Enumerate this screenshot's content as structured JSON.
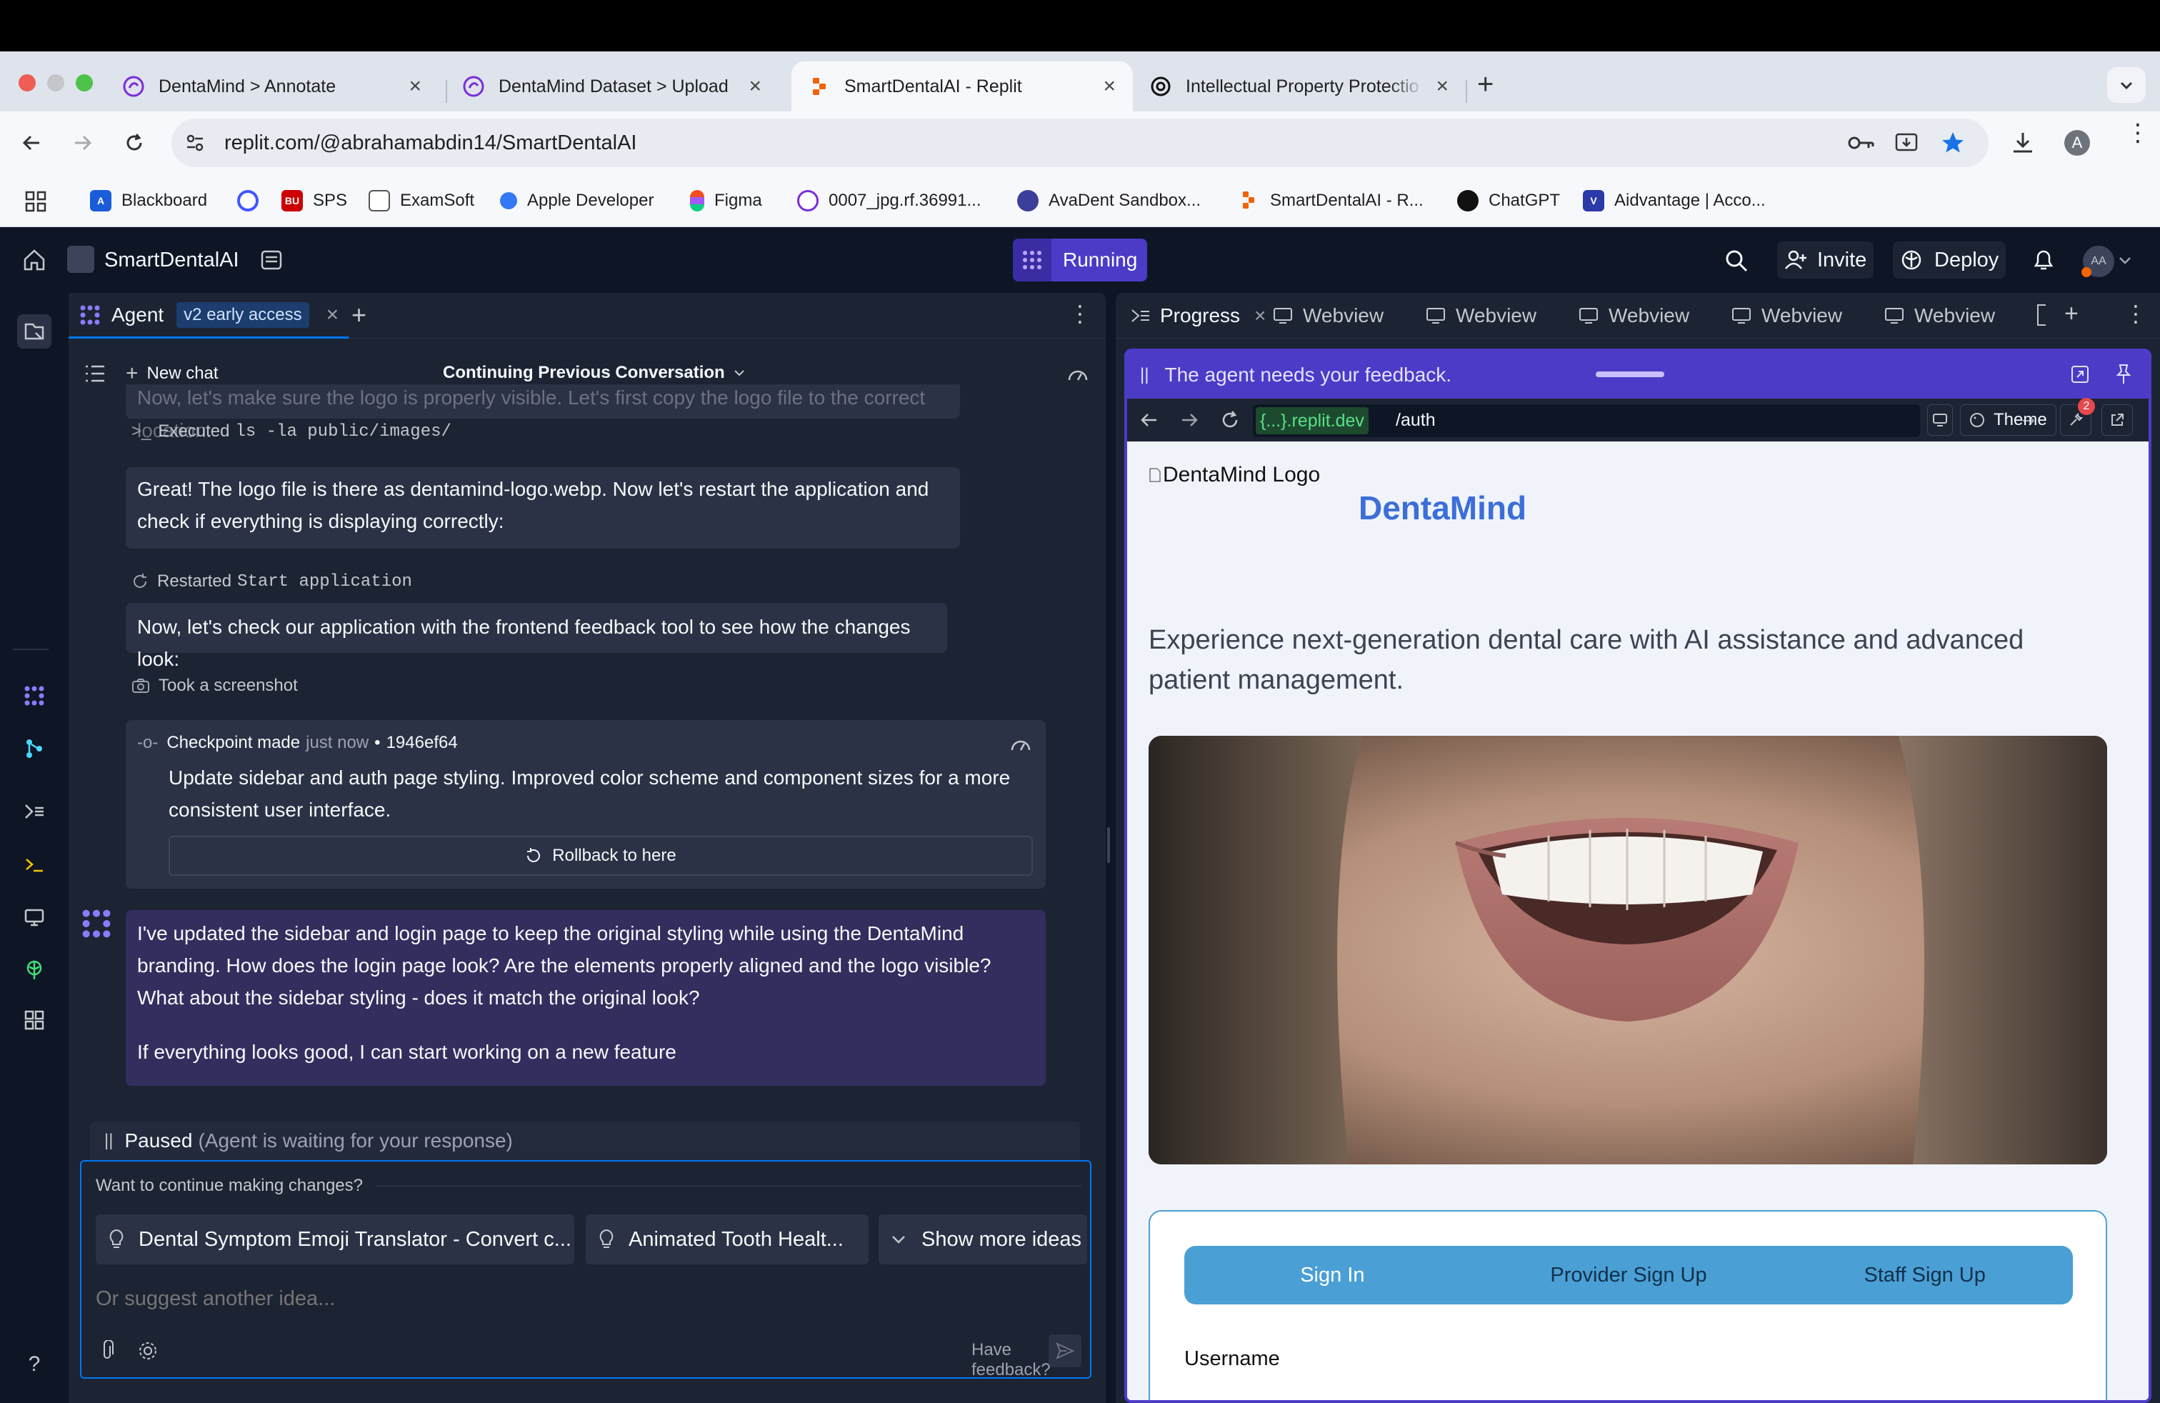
{
  "browser": {
    "tabs": [
      {
        "title": "DentaMind > Annotate",
        "favicon": "dentamind-icon"
      },
      {
        "title": "DentaMind Dataset > Upload",
        "favicon": "dentamind-icon"
      },
      {
        "title": "SmartDentalAI - Replit",
        "favicon": "replit-icon",
        "active": true
      },
      {
        "title": "Intellectual Property Protectio",
        "favicon": "chatgpt-icon"
      }
    ],
    "url": "replit.com/@abrahamabdin14/SmartDentalAI",
    "profile_initial": "A",
    "bookmarks": [
      {
        "label": "Blackboard",
        "icon": "blackboard-icon",
        "color": "#1a5dd8"
      },
      {
        "label": "",
        "icon": "quizlet-icon",
        "color": "#4255ff"
      },
      {
        "label": "SPS",
        "icon": "bu-icon",
        "color": "#cc0000",
        "badge": "BU"
      },
      {
        "label": "ExamSoft",
        "icon": "examsoft-icon",
        "color": "#555555"
      },
      {
        "label": "Apple Developer",
        "icon": "apple-icon",
        "color": "#3478f6"
      },
      {
        "label": "Figma",
        "icon": "figma-icon",
        "color": "#f24e1e"
      },
      {
        "label": "0007_jpg.rf.36991...",
        "icon": "dentamind-icon",
        "color": "#7b2fd6"
      },
      {
        "label": "AvaDent Sandbox...",
        "icon": "avadent-icon",
        "color": "#3b3f9a"
      },
      {
        "label": "SmartDentalAI - R...",
        "icon": "replit-icon",
        "color": "#f26207"
      },
      {
        "label": "ChatGPT",
        "icon": "chatgpt-icon",
        "color": "#111111"
      },
      {
        "label": "Aidvantage | Acco...",
        "icon": "aidvantage-icon",
        "color": "#2b3aa8",
        "badge": "V"
      }
    ]
  },
  "replit": {
    "project_name": "SmartDentalAI",
    "run_status": "Running",
    "invite_label": "Invite",
    "deploy_label": "Deploy",
    "avatar_initials": "AA",
    "colors": {
      "accent": "#5d3fd3",
      "background": "#0e1525",
      "surface": "#1c2333",
      "card": "#2b3245"
    }
  },
  "agent": {
    "tab_label": "Agent",
    "badge": "v2 early access",
    "new_chat_label": "New chat",
    "conversation_title": "Continuing Previous Conversation",
    "faded_message": "Now, let's make sure the logo is properly visible. Let's first copy the logo file to the correct location:",
    "executed_prefix": "Executed",
    "executed_command": "ls -la public/images/",
    "message_1": "Great! The logo file is there as dentamind-logo.webp. Now let's restart the application and check if everything is displaying correctly:",
    "restarted_prefix": "Restarted",
    "restarted_target": "Start application",
    "message_2": "Now, let's check our application with the frontend feedback tool to see how the changes look:",
    "screenshot_label": "Took a screenshot",
    "checkpoint": {
      "label": "Checkpoint made",
      "time": "just now",
      "hash": "1946ef64",
      "description": "Update sidebar and auth page styling. Improved color scheme and component sizes for a more consistent user interface.",
      "rollback_label": "Rollback to here"
    },
    "final_message_p1": "I've updated the sidebar and login page to keep the original styling while using the DentaMind branding. How does the login page look? Are the elements properly aligned and the logo visible? What about the sidebar styling - does it match the original look?",
    "final_message_p2": "If everything looks good, I can start working on a new feature",
    "paused_label": "Paused",
    "paused_detail": "(Agent is waiting for your response)",
    "prompt_heading": "Want to continue making changes?",
    "ideas": [
      "Dental Symptom Emoji Translator - Convert c...",
      "Animated Tooth Healt..."
    ],
    "show_more_label": "Show more ideas",
    "input_placeholder": "Or suggest another idea...",
    "feedback_label": "Have feedback?"
  },
  "right_panel": {
    "tabs": [
      {
        "label": "Progress",
        "icon": "progress-icon",
        "closable": true
      },
      {
        "label": "Webview",
        "icon": "monitor-icon"
      },
      {
        "label": "Webview",
        "icon": "monitor-icon"
      },
      {
        "label": "Webview",
        "icon": "monitor-icon"
      },
      {
        "label": "Webview",
        "icon": "monitor-icon"
      },
      {
        "label": "Webview",
        "icon": "monitor-icon"
      }
    ],
    "feedback_banner": "The agent needs your feedback.",
    "webview_domain": "{...}.replit.dev",
    "webview_path": "/auth",
    "theme_label": "Theme",
    "devtools_badge": "2"
  },
  "webview": {
    "logo_alt": "DentaMind Logo",
    "brand": "DentaMind",
    "tagline": "Experience next-generation dental care with AI assistance and advanced patient management.",
    "auth_tabs": [
      "Sign In",
      "Provider Sign Up",
      "Staff Sign Up"
    ],
    "username_label": "Username",
    "colors": {
      "brand": "#3b6fd8",
      "tab_bar": "#4a9fd5"
    }
  }
}
